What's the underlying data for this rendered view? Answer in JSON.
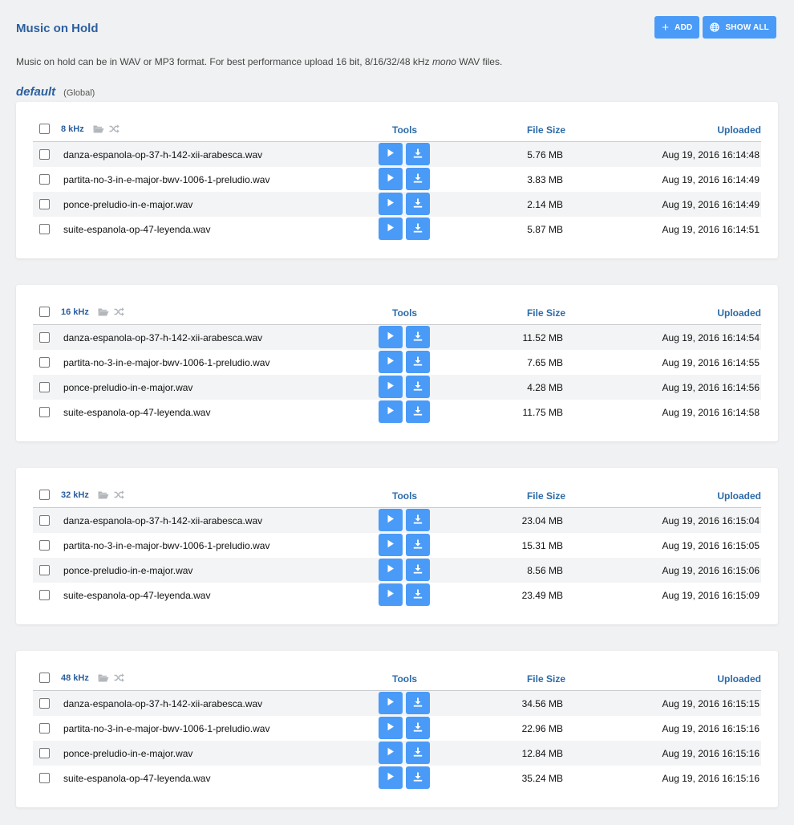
{
  "header": {
    "title": "Music on Hold",
    "add_label": "ADD",
    "show_all_label": "SHOW ALL"
  },
  "description": {
    "text_before": "Music on hold can be in WAV or MP3 format. For best performance upload 16 bit, 8/16/32/48 kHz ",
    "text_italic": "mono",
    "text_after": " WAV files."
  },
  "context": {
    "name": "default",
    "scope": "(Global)"
  },
  "columns": {
    "tools": "Tools",
    "file_size": "File Size",
    "uploaded": "Uploaded"
  },
  "colors": {
    "accent": "#4a9bf7",
    "heading": "#2c5f9e"
  },
  "groups": [
    {
      "rate": "8 kHz",
      "files": [
        {
          "name": "danza-espanola-op-37-h-142-xii-arabesca.wav",
          "size": "5.76 MB",
          "uploaded": "Aug 19, 2016 16:14:48"
        },
        {
          "name": "partita-no-3-in-e-major-bwv-1006-1-preludio.wav",
          "size": "3.83 MB",
          "uploaded": "Aug 19, 2016 16:14:49"
        },
        {
          "name": "ponce-preludio-in-e-major.wav",
          "size": "2.14 MB",
          "uploaded": "Aug 19, 2016 16:14:49"
        },
        {
          "name": "suite-espanola-op-47-leyenda.wav",
          "size": "5.87 MB",
          "uploaded": "Aug 19, 2016 16:14:51"
        }
      ]
    },
    {
      "rate": "16 kHz",
      "files": [
        {
          "name": "danza-espanola-op-37-h-142-xii-arabesca.wav",
          "size": "11.52 MB",
          "uploaded": "Aug 19, 2016 16:14:54"
        },
        {
          "name": "partita-no-3-in-e-major-bwv-1006-1-preludio.wav",
          "size": "7.65 MB",
          "uploaded": "Aug 19, 2016 16:14:55"
        },
        {
          "name": "ponce-preludio-in-e-major.wav",
          "size": "4.28 MB",
          "uploaded": "Aug 19, 2016 16:14:56"
        },
        {
          "name": "suite-espanola-op-47-leyenda.wav",
          "size": "11.75 MB",
          "uploaded": "Aug 19, 2016 16:14:58"
        }
      ]
    },
    {
      "rate": "32 kHz",
      "files": [
        {
          "name": "danza-espanola-op-37-h-142-xii-arabesca.wav",
          "size": "23.04 MB",
          "uploaded": "Aug 19, 2016 16:15:04"
        },
        {
          "name": "partita-no-3-in-e-major-bwv-1006-1-preludio.wav",
          "size": "15.31 MB",
          "uploaded": "Aug 19, 2016 16:15:05"
        },
        {
          "name": "ponce-preludio-in-e-major.wav",
          "size": "8.56 MB",
          "uploaded": "Aug 19, 2016 16:15:06"
        },
        {
          "name": "suite-espanola-op-47-leyenda.wav",
          "size": "23.49 MB",
          "uploaded": "Aug 19, 2016 16:15:09"
        }
      ]
    },
    {
      "rate": "48 kHz",
      "files": [
        {
          "name": "danza-espanola-op-37-h-142-xii-arabesca.wav",
          "size": "34.56 MB",
          "uploaded": "Aug 19, 2016 16:15:15"
        },
        {
          "name": "partita-no-3-in-e-major-bwv-1006-1-preludio.wav",
          "size": "22.96 MB",
          "uploaded": "Aug 19, 2016 16:15:16"
        },
        {
          "name": "ponce-preludio-in-e-major.wav",
          "size": "12.84 MB",
          "uploaded": "Aug 19, 2016 16:15:16"
        },
        {
          "name": "suite-espanola-op-47-leyenda.wav",
          "size": "35.24 MB",
          "uploaded": "Aug 19, 2016 16:15:16"
        }
      ]
    }
  ]
}
